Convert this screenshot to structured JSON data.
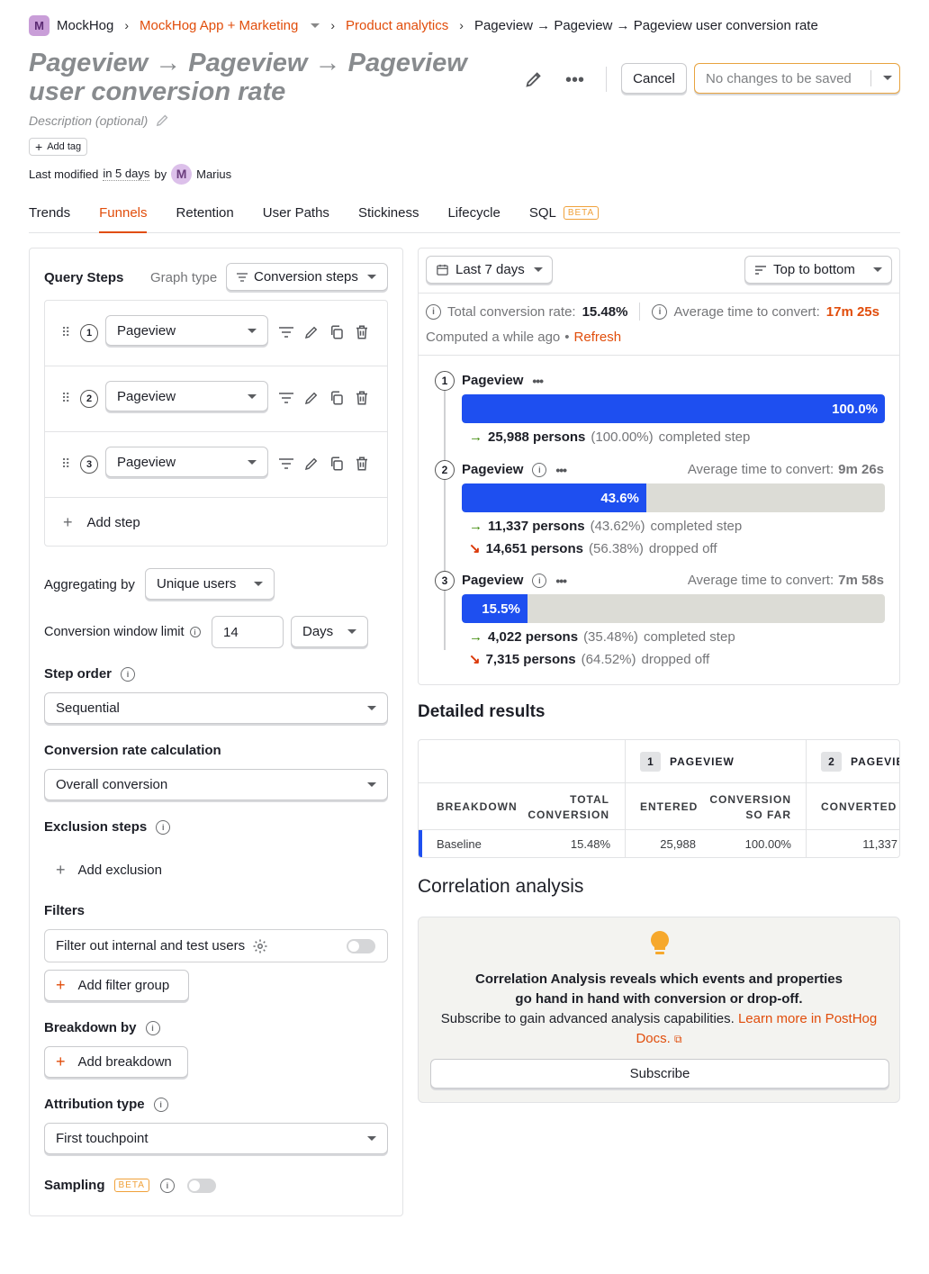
{
  "breadcrumb": {
    "org_initial": "M",
    "org": "MockHog",
    "project": "MockHog App + Marketing",
    "section": "Product analytics",
    "current": "Pageview → Pageview → Pageview user conversion rate"
  },
  "insight": {
    "title": "Pageview → Pageview → Pageview user conversion rate",
    "description_placeholder": "Description (optional)",
    "add_tag": "Add tag",
    "last_modified_prefix": "Last modified",
    "last_modified_when": "in 5 days",
    "by": "by",
    "user_initial": "M",
    "user": "Marius"
  },
  "header_actions": {
    "cancel": "Cancel",
    "save": "No changes to be saved"
  },
  "tabs": [
    {
      "label": "Trends"
    },
    {
      "label": "Funnels",
      "active": true
    },
    {
      "label": "Retention"
    },
    {
      "label": "User Paths"
    },
    {
      "label": "Stickiness"
    },
    {
      "label": "Lifecycle"
    },
    {
      "label": "SQL",
      "badge": "BETA"
    }
  ],
  "query": {
    "title": "Query Steps",
    "graph_type_label": "Graph type",
    "graph_type": "Conversion steps",
    "steps": [
      {
        "num": "1",
        "event": "Pageview"
      },
      {
        "num": "2",
        "event": "Pageview"
      },
      {
        "num": "3",
        "event": "Pageview"
      }
    ],
    "add_step": "Add step",
    "aggregating_label": "Aggregating by",
    "aggregating": "Unique users",
    "window_label": "Conversion window limit",
    "window_value": "14",
    "window_unit": "Days",
    "step_order_label": "Step order",
    "step_order": "Sequential",
    "conv_calc_label": "Conversion rate calculation",
    "conv_calc": "Overall conversion",
    "exclusion_label": "Exclusion steps",
    "add_exclusion": "Add exclusion",
    "filters_label": "Filters",
    "filter_internal": "Filter out internal and test users",
    "add_filter_group": "Add filter group",
    "breakdown_label": "Breakdown by",
    "add_breakdown": "Add breakdown",
    "attribution_label": "Attribution type",
    "attribution": "First touchpoint",
    "sampling_label": "Sampling",
    "sampling_badge": "BETA"
  },
  "results": {
    "date_range": "Last 7 days",
    "layout": "Top to bottom",
    "total_conv_label": "Total conversion rate:",
    "total_conv": "15.48%",
    "avg_time_label": "Average time to convert:",
    "avg_time": "17m 25s",
    "computed": "Computed a while ago",
    "bullet": "•",
    "refresh": "Refresh",
    "steps": [
      {
        "num": "1",
        "name": "Pageview",
        "pct": 100.0,
        "pct_label": "100.0%",
        "completed_count": "25,988 persons",
        "completed_pct": "(100.00%)",
        "completed_text": "completed step"
      },
      {
        "num": "2",
        "name": "Pageview",
        "pct": 43.6,
        "pct_label": "43.6%",
        "avg_label": "Average time to convert:",
        "avg": "9m 26s",
        "completed_count": "11,337 persons",
        "completed_pct": "(43.62%)",
        "completed_text": "completed step",
        "dropped_count": "14,651 persons",
        "dropped_pct": "(56.38%)",
        "dropped_text": "dropped off"
      },
      {
        "num": "3",
        "name": "Pageview",
        "pct": 15.5,
        "pct_label": "15.5%",
        "avg_label": "Average time to convert:",
        "avg": "7m 58s",
        "completed_count": "4,022 persons",
        "completed_pct": "(35.48%)",
        "completed_text": "completed step",
        "dropped_count": "7,315 persons",
        "dropped_pct": "(64.52%)",
        "dropped_text": "dropped off"
      }
    ]
  },
  "detailed": {
    "title": "Detailed results",
    "step1_num": "1",
    "step1_name": "PAGEVIEW",
    "step2_num": "2",
    "step2_name": "PAGEVIE",
    "col_breakdown": "BREAKDOWN",
    "col_total_1": "TOTAL",
    "col_total_2": "CONVERSION",
    "col_entered": "ENTERED",
    "col_conv_1": "CONVERSION",
    "col_conv_2": "SO FAR",
    "col_converted": "CONVERTED",
    "row": {
      "breakdown": "Baseline",
      "total": "15.48%",
      "entered": "25,988",
      "so_far": "100.00%",
      "converted": "11,337"
    }
  },
  "correlation": {
    "title": "Correlation analysis",
    "headline_1": "Correlation Analysis reveals which events and properties",
    "headline_2": "go hand in hand with conversion or drop-off.",
    "sub": "Subscribe to gain advanced analysis capabilities.",
    "link_1": "Learn more in PostHog",
    "link_2": "Docs.",
    "subscribe": "Subscribe"
  },
  "colors": {
    "accent": "#e14d0b",
    "bar": "#1e4ff0",
    "bar_bg": "#dcdcd6",
    "green": "#388600",
    "red": "#db3707"
  }
}
